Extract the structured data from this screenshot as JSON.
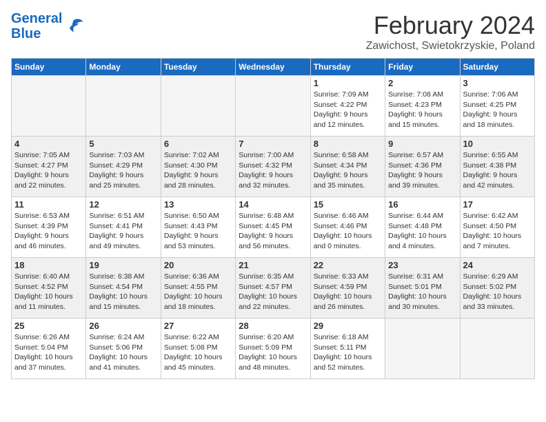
{
  "logo": {
    "line1": "General",
    "line2": "Blue"
  },
  "title": "February 2024",
  "subtitle": "Zawichost, Swietokrzyskie, Poland",
  "days_of_week": [
    "Sunday",
    "Monday",
    "Tuesday",
    "Wednesday",
    "Thursday",
    "Friday",
    "Saturday"
  ],
  "weeks": [
    {
      "shaded": false,
      "days": [
        {
          "num": "",
          "info": ""
        },
        {
          "num": "",
          "info": ""
        },
        {
          "num": "",
          "info": ""
        },
        {
          "num": "",
          "info": ""
        },
        {
          "num": "1",
          "info": "Sunrise: 7:09 AM\nSunset: 4:22 PM\nDaylight: 9 hours\nand 12 minutes."
        },
        {
          "num": "2",
          "info": "Sunrise: 7:08 AM\nSunset: 4:23 PM\nDaylight: 9 hours\nand 15 minutes."
        },
        {
          "num": "3",
          "info": "Sunrise: 7:06 AM\nSunset: 4:25 PM\nDaylight: 9 hours\nand 18 minutes."
        }
      ]
    },
    {
      "shaded": true,
      "days": [
        {
          "num": "4",
          "info": "Sunrise: 7:05 AM\nSunset: 4:27 PM\nDaylight: 9 hours\nand 22 minutes."
        },
        {
          "num": "5",
          "info": "Sunrise: 7:03 AM\nSunset: 4:29 PM\nDaylight: 9 hours\nand 25 minutes."
        },
        {
          "num": "6",
          "info": "Sunrise: 7:02 AM\nSunset: 4:30 PM\nDaylight: 9 hours\nand 28 minutes."
        },
        {
          "num": "7",
          "info": "Sunrise: 7:00 AM\nSunset: 4:32 PM\nDaylight: 9 hours\nand 32 minutes."
        },
        {
          "num": "8",
          "info": "Sunrise: 6:58 AM\nSunset: 4:34 PM\nDaylight: 9 hours\nand 35 minutes."
        },
        {
          "num": "9",
          "info": "Sunrise: 6:57 AM\nSunset: 4:36 PM\nDaylight: 9 hours\nand 39 minutes."
        },
        {
          "num": "10",
          "info": "Sunrise: 6:55 AM\nSunset: 4:38 PM\nDaylight: 9 hours\nand 42 minutes."
        }
      ]
    },
    {
      "shaded": false,
      "days": [
        {
          "num": "11",
          "info": "Sunrise: 6:53 AM\nSunset: 4:39 PM\nDaylight: 9 hours\nand 46 minutes."
        },
        {
          "num": "12",
          "info": "Sunrise: 6:51 AM\nSunset: 4:41 PM\nDaylight: 9 hours\nand 49 minutes."
        },
        {
          "num": "13",
          "info": "Sunrise: 6:50 AM\nSunset: 4:43 PM\nDaylight: 9 hours\nand 53 minutes."
        },
        {
          "num": "14",
          "info": "Sunrise: 6:48 AM\nSunset: 4:45 PM\nDaylight: 9 hours\nand 56 minutes."
        },
        {
          "num": "15",
          "info": "Sunrise: 6:46 AM\nSunset: 4:46 PM\nDaylight: 10 hours\nand 0 minutes."
        },
        {
          "num": "16",
          "info": "Sunrise: 6:44 AM\nSunset: 4:48 PM\nDaylight: 10 hours\nand 4 minutes."
        },
        {
          "num": "17",
          "info": "Sunrise: 6:42 AM\nSunset: 4:50 PM\nDaylight: 10 hours\nand 7 minutes."
        }
      ]
    },
    {
      "shaded": true,
      "days": [
        {
          "num": "18",
          "info": "Sunrise: 6:40 AM\nSunset: 4:52 PM\nDaylight: 10 hours\nand 11 minutes."
        },
        {
          "num": "19",
          "info": "Sunrise: 6:38 AM\nSunset: 4:54 PM\nDaylight: 10 hours\nand 15 minutes."
        },
        {
          "num": "20",
          "info": "Sunrise: 6:36 AM\nSunset: 4:55 PM\nDaylight: 10 hours\nand 18 minutes."
        },
        {
          "num": "21",
          "info": "Sunrise: 6:35 AM\nSunset: 4:57 PM\nDaylight: 10 hours\nand 22 minutes."
        },
        {
          "num": "22",
          "info": "Sunrise: 6:33 AM\nSunset: 4:59 PM\nDaylight: 10 hours\nand 26 minutes."
        },
        {
          "num": "23",
          "info": "Sunrise: 6:31 AM\nSunset: 5:01 PM\nDaylight: 10 hours\nand 30 minutes."
        },
        {
          "num": "24",
          "info": "Sunrise: 6:29 AM\nSunset: 5:02 PM\nDaylight: 10 hours\nand 33 minutes."
        }
      ]
    },
    {
      "shaded": false,
      "days": [
        {
          "num": "25",
          "info": "Sunrise: 6:26 AM\nSunset: 5:04 PM\nDaylight: 10 hours\nand 37 minutes."
        },
        {
          "num": "26",
          "info": "Sunrise: 6:24 AM\nSunset: 5:06 PM\nDaylight: 10 hours\nand 41 minutes."
        },
        {
          "num": "27",
          "info": "Sunrise: 6:22 AM\nSunset: 5:08 PM\nDaylight: 10 hours\nand 45 minutes."
        },
        {
          "num": "28",
          "info": "Sunrise: 6:20 AM\nSunset: 5:09 PM\nDaylight: 10 hours\nand 48 minutes."
        },
        {
          "num": "29",
          "info": "Sunrise: 6:18 AM\nSunset: 5:11 PM\nDaylight: 10 hours\nand 52 minutes."
        },
        {
          "num": "",
          "info": ""
        },
        {
          "num": "",
          "info": ""
        }
      ]
    }
  ]
}
